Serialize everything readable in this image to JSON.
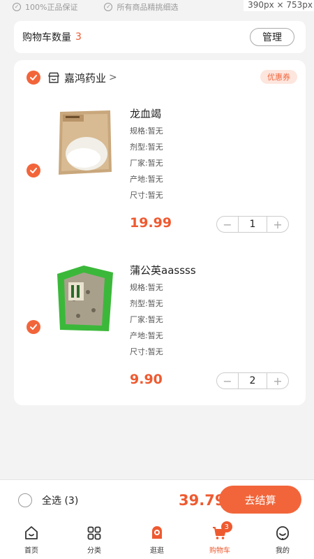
{
  "top_strip": {
    "guarantee": "100%正品保证",
    "selection": "所有商品精挑细选",
    "size_label": "390px × 753px"
  },
  "cart_header": {
    "label": "购物车数量",
    "count": "3",
    "manage_label": "管理"
  },
  "store": {
    "name": "嘉鸿药业",
    "arrow": ">",
    "coupon_label": "优惠券"
  },
  "items": [
    {
      "title": "龙血竭",
      "spec": "规格:暂无",
      "form": "剂型:暂无",
      "maker": "厂家:暂无",
      "origin": "产地:暂无",
      "size": "尺寸:暂无",
      "price": "19.99",
      "qty": "1",
      "image": "white-powder-bag",
      "checked": true
    },
    {
      "title": "蒲公英aassss",
      "spec": "规格:暂无",
      "form": "剂型:暂无",
      "maker": "厂家:暂无",
      "origin": "产地:暂无",
      "size": "尺寸:暂无",
      "price": "9.90",
      "qty": "2",
      "image": "green-herb-bag",
      "checked": true
    }
  ],
  "checkout": {
    "select_all_label": "全选 (3)",
    "total": "39.79",
    "button_label": "去结算"
  },
  "tabbar": [
    {
      "label": "首页",
      "icon": "home-icon"
    },
    {
      "label": "分类",
      "icon": "grid-icon"
    },
    {
      "label": "逛逛",
      "icon": "discover-icon"
    },
    {
      "label": "购物车",
      "icon": "cart-icon",
      "badge": "3",
      "active": true
    },
    {
      "label": "我的",
      "icon": "profile-icon"
    }
  ],
  "colors": {
    "accent": "#f2653a",
    "price": "#ee5a30",
    "coupon_bg": "#fde6de",
    "background": "#f3f3f3"
  }
}
